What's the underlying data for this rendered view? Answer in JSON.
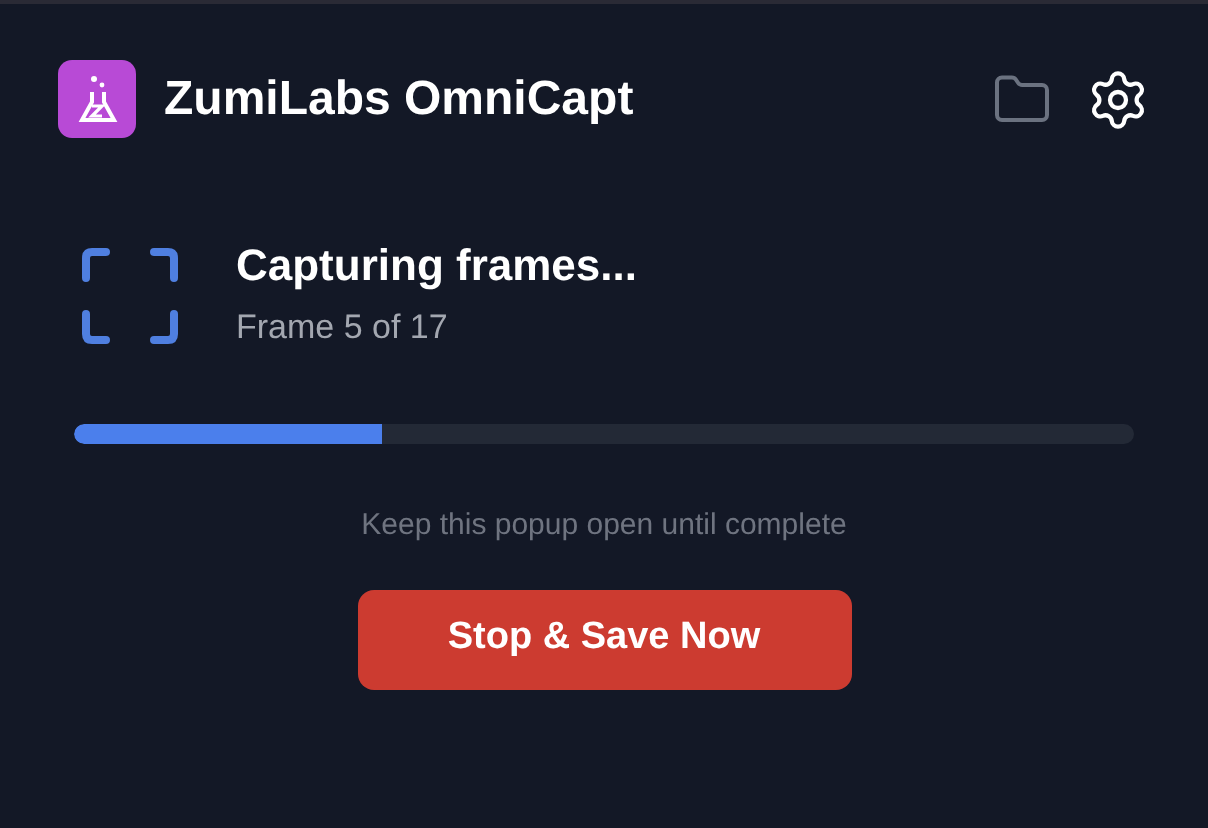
{
  "header": {
    "title": "ZumiLabs OmniCapt"
  },
  "status": {
    "title": "Capturing frames...",
    "subtitle": "Frame 5 of 17"
  },
  "progress": {
    "level": 0.29
  },
  "hint": "Keep this popup open until complete",
  "button": {
    "label": "Stop & Save Now"
  }
}
